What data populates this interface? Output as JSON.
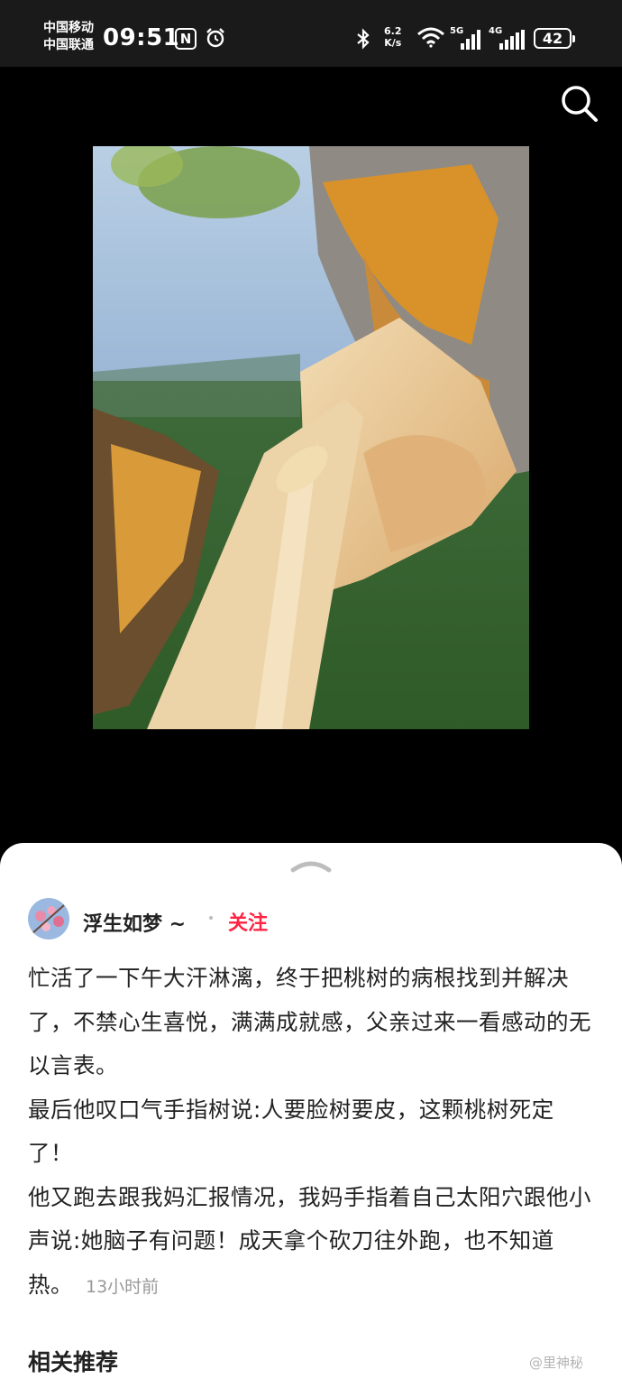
{
  "status_bar": {
    "carrier_1": "中国移动",
    "carrier_2": "中国联通",
    "time": "09:51",
    "nfc_glyph": "N",
    "net_speed_value": "6.2",
    "net_speed_unit": "K/s",
    "sig1_label": "5G",
    "sig2_label": "4G",
    "battery": "42",
    "icons": [
      "nfc-icon",
      "alarm-icon",
      "bluetooth-icon",
      "wifi-icon",
      "signal-icon",
      "battery-icon"
    ]
  },
  "toolbar": {
    "search_icon": "search-icon"
  },
  "post": {
    "author": "浮生如梦 ~",
    "follow_label": "关注",
    "paragraphs": [
      "忙活了一下午大汗淋漓，终于把桃树的病根找到并解决了，不禁心生喜悦，满满成就感，父亲过来一看感动的无以言表。",
      "最后他叹口气手指树说:人要脸树要皮，这颗桃树死定了！",
      "他又跑去跟我妈汇报情况，我妈手指着自己太阳穴跟他小声说:她脑子有问题！成天拿个砍刀往外跑，也不知道热。"
    ],
    "timestamp": "13小时前"
  },
  "related": {
    "title": "相关推荐"
  },
  "watermark": "@里神秘",
  "colors": {
    "accent": "#ff2442",
    "sheet_bg": "#ffffff",
    "page_bg": "#000000",
    "status_bg": "#1a1a1a"
  }
}
